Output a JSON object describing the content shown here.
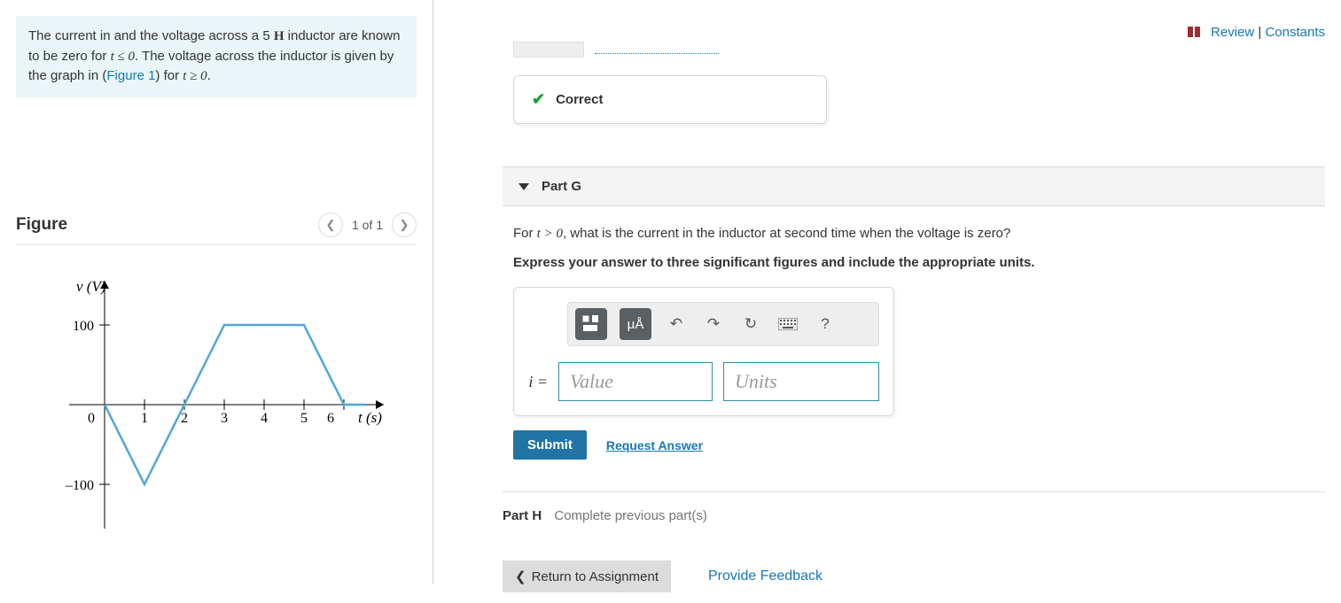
{
  "top_links": {
    "review": "Review",
    "constants": "Constants",
    "sep": " | "
  },
  "intro": {
    "p1a": "The current in and the voltage across a 5 ",
    "unitH": "H",
    "p1b": " inductor are known to be zero for ",
    "tvar1": "t",
    "le": " ≤ 0",
    "p1c": ". The voltage across the inductor is given by the graph in (",
    "figlink": "Figure 1",
    "p1d": ") for ",
    "tvar2": "t",
    "ge": " ≥ 0",
    "p1e": "."
  },
  "figure": {
    "heading": "Figure",
    "pager": "1 of 1",
    "ylabel": "v (V)",
    "xlabel": "t (s)"
  },
  "chart_data": {
    "type": "line",
    "title": "",
    "xlabel": "t (s)",
    "ylabel": "v (V)",
    "xlim": [
      0,
      6.5
    ],
    "ylim": [
      -120,
      120
    ],
    "x_ticks": [
      0,
      1,
      2,
      3,
      4,
      5,
      6
    ],
    "y_ticks": [
      -100,
      0,
      100
    ],
    "series": [
      {
        "name": "v(t)",
        "x": [
          0,
          1,
          2,
          3,
          5,
          6,
          6.5
        ],
        "values": [
          0,
          -100,
          0,
          100,
          100,
          0,
          0
        ]
      }
    ]
  },
  "feedback": {
    "correct": "Correct"
  },
  "partG": {
    "title": "Part G",
    "q1a": "For ",
    "tvar": "t",
    "gt": " > 0",
    "q1b": ", what is the current in the inductor at second time when the voltage is zero?",
    "instruction": "Express your answer to three significant figures and include the appropriate units.",
    "ieq": "i =",
    "value_ph": "Value",
    "units_ph": "Units",
    "mu_label": "μÅ",
    "submit": "Submit",
    "request": "Request Answer"
  },
  "partH": {
    "title": "Part H",
    "status": "Complete previous part(s)"
  },
  "bottom": {
    "return": "Return to Assignment",
    "feedback": "Provide Feedback"
  }
}
